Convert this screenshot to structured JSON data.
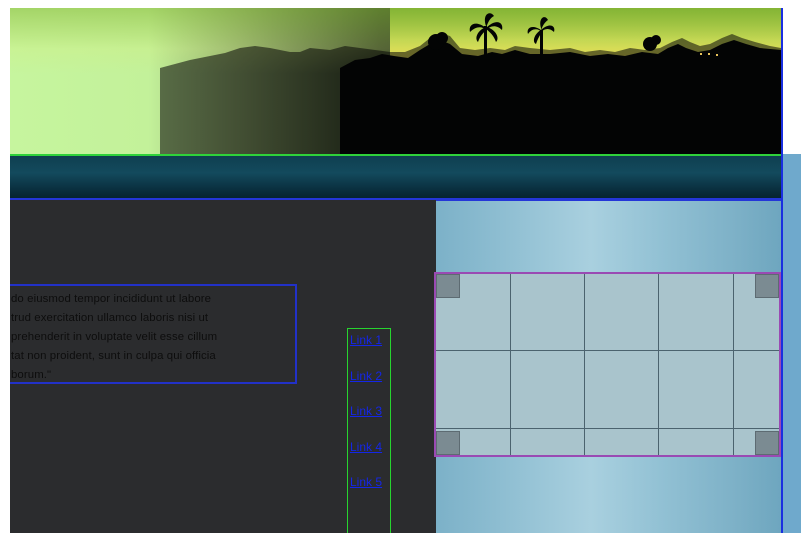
{
  "quote": {
    "lines": [
      "do eiusmod tempor incididunt ut labore",
      "trud exercitation ullamco laboris nisi ut",
      "prehenderit in voluptate velit esse cillum",
      "tat non proident, sunt in culpa qui officia",
      "borum.\""
    ]
  },
  "links": [
    "Link 1",
    "Link 2",
    "Link 3",
    "Link 4",
    "Link 5"
  ],
  "colors": {
    "page_background": "#2b2c2e",
    "link": "#1426e8",
    "border_blue": "#2231c8",
    "border_green": "#27d42f",
    "widget_border": "#9a4ab3",
    "panel_blue": "#8dbdd1",
    "banner_green": "#c6f59e",
    "navbar_teal": "#134a5d"
  }
}
